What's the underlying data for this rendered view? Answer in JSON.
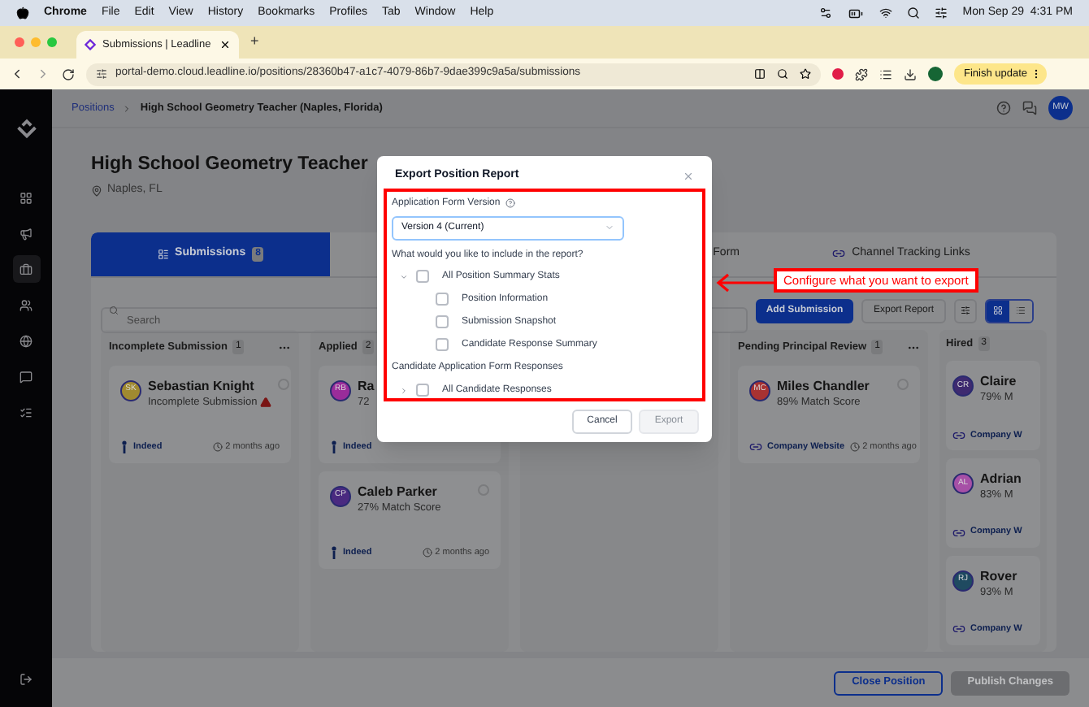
{
  "menubar": {
    "app": "Chrome",
    "items": [
      "File",
      "Edit",
      "View",
      "History",
      "Bookmarks",
      "Profiles",
      "Tab",
      "Window",
      "Help"
    ],
    "clock": "Mon Sep 29  4:31 PM"
  },
  "browser": {
    "tab_title": "Submissions | Leadline",
    "new_tab": "+",
    "url": "portal-demo.cloud.leadline.io/positions/28360b47-a1c7-4079-86b7-9dae399c9a5a/submissions",
    "update_button": "Finish update"
  },
  "breadcrumb": [
    "Positions",
    "High School Geometry Teacher (Naples, Florida)"
  ],
  "user_avatar": "MW",
  "position": {
    "title": "High School Geometry Teacher",
    "location": "Naples, FL"
  },
  "tabs": [
    {
      "label": "Submissions",
      "count": "8",
      "selected": true
    },
    {
      "label": "Form",
      "selected": false
    },
    {
      "label": "Channel Tracking Links",
      "selected": false
    }
  ],
  "search": {
    "placeholder": "Search"
  },
  "actions": [
    "Add Submission",
    "Export Report"
  ],
  "view_toggle": [
    {
      "kind": "board",
      "selected": true
    },
    {
      "kind": "list",
      "selected": false
    }
  ],
  "columns": [
    {
      "title": "Incomplete Submission",
      "count": "1",
      "more_menu": true,
      "cards": [
        {
          "initials": "SK",
          "color": "#a08a30",
          "name": "Sebastian Knight",
          "subtitle": "Incomplete Submission",
          "warning": true,
          "checked": false,
          "source": "Indeed",
          "kind": "indeed",
          "time": "2 months ago"
        }
      ]
    },
    {
      "title": "Applied",
      "count": "2",
      "more_menu": false,
      "cards": [
        {
          "initials": "RB",
          "color": "#9a2c9a",
          "name": "Ra",
          "subtitle": "72",
          "warning": false,
          "source": "Indeed",
          "kind": "indeed"
        },
        {
          "initials": "CP",
          "color": "#4a2a80",
          "name": "Caleb Parker",
          "subtitle": "27% Match Score",
          "warning": false,
          "checked": false,
          "source": "Indeed",
          "kind": "indeed",
          "time": "2 months ago"
        }
      ]
    },
    {
      "title": "Pending Principal Review",
      "count": "1",
      "more_menu": true,
      "cards": [
        {
          "initials": "MC",
          "color": "#a83232",
          "name": "Miles Chandler",
          "subtitle": "89% Match Score",
          "warning": false,
          "checked": false,
          "source": "Company Website",
          "kind": "website",
          "time": "2 months ago"
        }
      ]
    },
    {
      "title": "Hired",
      "count": "3",
      "more_menu": false,
      "cards": [
        {
          "initials": "CR",
          "color": "#3e2a70",
          "name": "Claire",
          "subtitle": "79% M",
          "warning": false,
          "source": "Company W",
          "kind": "website"
        },
        {
          "initials": "AL",
          "color": "#a650a6",
          "name": "Adrian",
          "subtitle": "83% M",
          "warning": false,
          "source": "Company W",
          "kind": "website"
        },
        {
          "initials": "RJ",
          "color": "#1f4a60",
          "name": "Rover",
          "subtitle": "93% M",
          "warning": false,
          "source": "Company W",
          "kind": "website"
        }
      ]
    }
  ],
  "footer": [
    {
      "label": "Close Position",
      "kind": "outline"
    },
    {
      "label": "Publish Changes",
      "kind": "disabled"
    }
  ],
  "dialog": {
    "title": "Export Position Report",
    "version_label": "Application Form Version",
    "version": "Version 4 (Current)",
    "question": "What would you like to include in the report?",
    "sections": [
      {
        "kind": "group",
        "label": "All Position Summary Stats",
        "checked": false,
        "expanded": true,
        "children": [
          {
            "label": "Position Information",
            "checked": false
          },
          {
            "label": "Submission Snapshot",
            "checked": false
          },
          {
            "label": "Candidate Response Summary",
            "checked": false
          }
        ]
      },
      {
        "kind": "heading",
        "label": "Candidate Application Form Responses"
      },
      {
        "kind": "group",
        "label": "All Candidate Responses",
        "checked": false,
        "expanded": false
      }
    ],
    "buttons": [
      {
        "label": "Cancel",
        "disabled": false
      },
      {
        "label": "Export",
        "disabled": true
      }
    ]
  },
  "callout": "Configure what you want to export"
}
